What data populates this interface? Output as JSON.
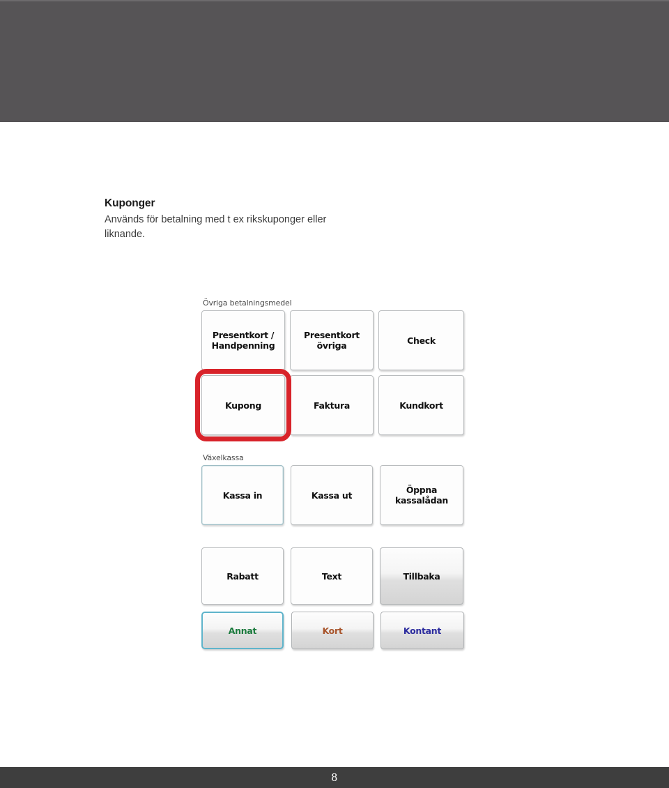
{
  "page": {
    "number": "8"
  },
  "article": {
    "heading": "Kuponger",
    "body": "Används för betalning med t ex rikskuponger eller liknande."
  },
  "pos_screenshot": {
    "groups": [
      {
        "label": "Övriga betalningsmedel",
        "rows": [
          {
            "buttons": [
              {
                "label": "Presentkort /\nHandpenning",
                "state": "normal"
              },
              {
                "label": "Presentkort\növriga",
                "state": "normal"
              },
              {
                "label": "Check",
                "state": "normal"
              }
            ]
          },
          {
            "buttons": [
              {
                "label": "Kupong",
                "state": "highlighted"
              },
              {
                "label": "Faktura",
                "state": "normal"
              },
              {
                "label": "Kundkort",
                "state": "normal"
              }
            ]
          }
        ]
      },
      {
        "label": "Växelkassa",
        "rows": [
          {
            "buttons": [
              {
                "label": "Kassa in",
                "state": "focused"
              },
              {
                "label": "Kassa ut",
                "state": "normal"
              },
              {
                "label": "Öppna\nkassalådan",
                "state": "normal"
              }
            ]
          }
        ]
      },
      {
        "label": "",
        "rows": [
          {
            "buttons": [
              {
                "label": "Rabatt",
                "state": "normal"
              },
              {
                "label": "Text",
                "state": "normal"
              },
              {
                "label": "Tillbaka",
                "state": "gradient"
              }
            ]
          },
          {
            "buttons": [
              {
                "label": "Annat",
                "state": "cyan-focus",
                "text_color": "#1b7a3d"
              },
              {
                "label": "Kort",
                "state": "gradient",
                "text_color": "#a8542b"
              },
              {
                "label": "Kontant",
                "state": "gradient",
                "text_color": "#2b2b9e"
              }
            ]
          }
        ]
      }
    ],
    "annotation": {
      "target": "Kupong",
      "shape": "rounded-rectangle",
      "color": "#d8232a"
    }
  },
  "colors": {
    "header_band": "#565456",
    "footer_band": "#3e3e3e",
    "highlight_red": "#d8232a",
    "focus_cyan": "#5fb4cb",
    "annat_green": "#1b7a3d",
    "kort_orange": "#a8542b",
    "kontant_blue": "#2b2b9e"
  }
}
